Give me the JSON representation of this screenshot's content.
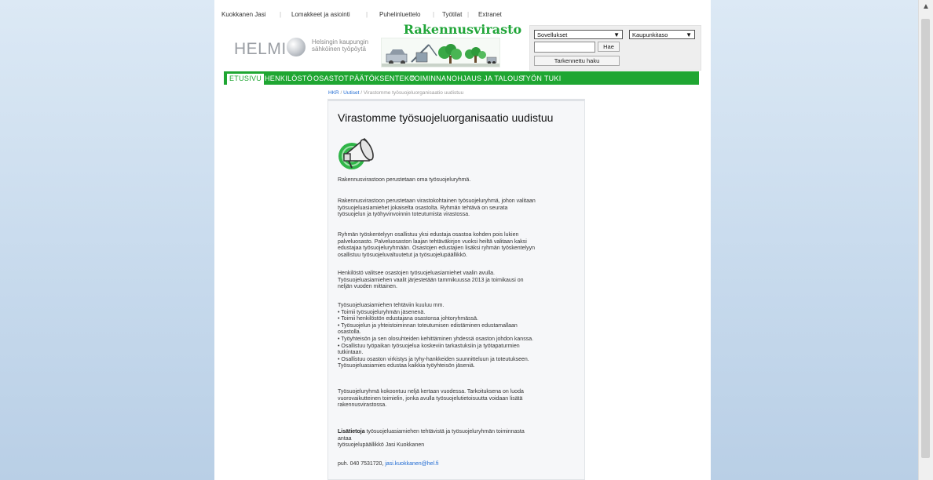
{
  "toplinks": [
    "Kuokkanen Jasi",
    "Lomakkeet ja asiointi",
    "Puhelinluettelo",
    "Työtilat",
    "Extranet"
  ],
  "branding": {
    "helmi": "HELMI",
    "helmi_sub1": "Helsingin kaupungin",
    "helmi_sub2": "sähköinen työpöytä",
    "title": "Rakennusvirasto"
  },
  "search": {
    "apps_select": "Sovellukset",
    "level_select": "Kaupunkitaso",
    "input_value": "",
    "search_button": "Hae",
    "advanced_button": "Tarkennettu haku"
  },
  "nav": [
    "ETUSIVU",
    "HENKILÖSTÖ",
    "OSASTOT",
    "PÄÄTÖKSENTEKO",
    "TOIMINNANOHJAUS JA TALOUS",
    "TYÖN TUKI"
  ],
  "breadcrumb": {
    "home": "HKR",
    "sep": " / ",
    "section": "Uutiset",
    "current": "Virastomme työsuojeluorganisaatio uudistuu"
  },
  "article": {
    "title": "Virastomme työsuojeluorganisaatio uudistuu",
    "intro": "Rakennusvirastoon perustetaan oma työsuojeluryhmä.",
    "p1": [
      "Rakennusvirastoon perustetaan virastokohtainen työsuojeluryhmä, johon valitaan",
      "työsuojeluasiamiehet jokaiselta osastolta.  Ryhmän tehtävä on seurata",
      "työsuojelun ja työhyvinvoinnin toteutumista virastossa."
    ],
    "p2": [
      "Ryhmän työskentelyyn osallistuu yksi edustaja osastoa kohden pois lukien",
      "palveluosasto. Palveluosaston laajan tehtäväkirjon vuoksi heiltä valitaan kaksi",
      "edustajaa työsuojeluryhmään. Osastojen edustajien lisäksi ryhmän työskentelyyn",
      "osallistuu työsuojeluvaltuutetut ja työsuojelupäällikkö."
    ],
    "p3": [
      "Henkilöstö valitsee osastojen työsuojeluasiamiehet vaalin avulla.",
      "Työsuojeluasiamiehen vaalit järjestetään tammikuussa 2013 ja toimikausi on",
      "neljän vuoden mittainen."
    ],
    "p4": [
      "Työsuojeluasiamiehen tehtäviin kuuluu mm.",
      "• Toimii työsuojeluryhmän jäsenenä.",
      "• Toimii henkilöstön edustajana osastonsa johtoryhmässä.",
      "• Työsuojelun ja yhteistoiminnan toteutumisen edistäminen edustamallaan",
      "osastolla.",
      "• Työyhteisön ja sen olosuhteiden kehittäminen yhdessä osaston johdon kanssa.",
      "• Osallistuu työpaikan työsuojelua koskeviin tarkastuksiin ja työtapaturmien",
      "tutkintaan.",
      "• Osallistuu osaston virkistys ja tyhy-hankkeiden suunnitteluun ja toteutukseen.",
      "Työsuojeluasiamies edustaa kaikkia työyhteisön jäseniä."
    ],
    "p5": [
      "Työsuojeluryhmä kokoontuu neljä kertaan vuodessa. Tarkoituksena on luoda",
      "vuorovaikutteinen toimielin, jonka avulla työsuojelutietoisuutta voidaan lisätä",
      "rakennusvirastossa."
    ],
    "info_bold": "Lisätietoja",
    "info_rest": " työsuojeluasiamiehen tehtävistä ja työsuojeluryhmän toiminnasta",
    "info_line2": "antaa",
    "info_line3": "työsuojelupäällikkö Jasi Kuokkanen",
    "phone_prefix": "puh. 040 7531720, ",
    "email": "jasi.kuokkanen@hel.fi"
  },
  "icons": {
    "megaphone": "megaphone-icon",
    "select_arrow": "chevron-down-icon",
    "scroll_up": "scroll-up-arrow-icon",
    "helmi_logo": "pearl-logo-icon"
  },
  "colors": {
    "nav_green": "#1fa632",
    "title_green": "#22a63a",
    "link_blue": "#1f6ad2"
  }
}
